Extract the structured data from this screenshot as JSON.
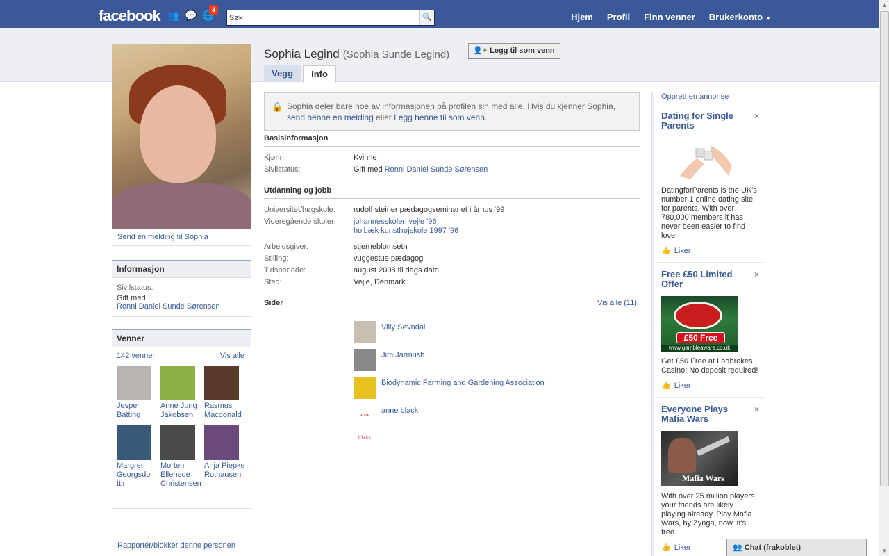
{
  "topbar": {
    "logo": "facebook",
    "notifications_count": "3",
    "search_value": "Søk",
    "nav": [
      "Hjem",
      "Profil",
      "Finn venner",
      "Brukerkonto"
    ]
  },
  "profile": {
    "name": "Sophia Legind",
    "altname": "(Sophia Sunde Legind)",
    "add_friend": "Legg til som venn",
    "tabs": [
      "Vegg",
      "Info"
    ],
    "send_message": "Send en melding til Sophia"
  },
  "sidebar": {
    "info_title": "Informasjon",
    "info_label": "Sivilstatus:",
    "info_value": "Gift med",
    "info_link": "Ronni Daniel Sunde Sørensen",
    "friends_title": "Venner",
    "friends_count": "142 venner",
    "friends_all": "Vis alle",
    "friends": [
      {
        "name": "Jesper Batting",
        "color": "#b9b4b0"
      },
      {
        "name": "Anne Jung Jakobsen",
        "color": "#8cb044"
      },
      {
        "name": "Rasmus Macdonald",
        "color": "#5a3a2a"
      },
      {
        "name": "Margret Georgsdo ttir",
        "color": "#3a5a7a"
      },
      {
        "name": "Morten Ellehede Christensen",
        "color": "#4a4a4a"
      },
      {
        "name": "Anja Piepke Rothausen",
        "color": "#6a4a7a"
      }
    ],
    "report": "Rapportér/blokkér denne personen"
  },
  "notice": {
    "text1": "Sophia deler bare noe av informasjonen på profilen sin med alle. Hvis du kjenner Sophia,",
    "link1": "send henne en melding",
    "text2": "eller",
    "link2": "Legg henne til som venn",
    "text3": "."
  },
  "basic": {
    "title": "Basisinformasjon",
    "rows": [
      {
        "k": "Kjønn:",
        "v": "Kvinne",
        "link": ""
      },
      {
        "k": "Sivilstatus:",
        "v": "Gift med",
        "link": "Ronni Daniel Sunde Sørensen"
      }
    ]
  },
  "education": {
    "title": "Utdanning og jobb",
    "university_label": "Universitet/høgskole:",
    "university": "rudolf steiner pædagogseminariet i århus '99",
    "school_label": "Videregående skoler:",
    "school1": "johannesskolen vejle '96",
    "school2": "holbæk kunsthøjskole 1997 '96",
    "employer_label": "Arbeidsgiver:",
    "employer": "stjerneblomsetn",
    "position_label": "Stilling:",
    "position": "vuggestue pædagog",
    "period_label": "Tidsperiode:",
    "period": "august 2008 til dags dato",
    "place_label": "Sted:",
    "place": "Vejle, Denmark"
  },
  "pages": {
    "title": "Sider",
    "see_all": "Vis alle (11)",
    "items": [
      {
        "name": "Villy Søvndal",
        "color": "#c8c0b0"
      },
      {
        "name": "Jim Jarmush",
        "color": "#888888"
      },
      {
        "name": "Biodynamic Farming and Gardening Association",
        "color": "#e8c020"
      },
      {
        "name": "anne black",
        "color": "#ffffff"
      }
    ],
    "anne_black_logo": "anne black"
  },
  "ads": {
    "create": "Opprett en annonse",
    "like": "Liker",
    "items": [
      {
        "title": "Dating for Single Parents",
        "text": "DatingforParents is the UK's number 1 online dating site for parents. With over 780,000 members it has never been easier to find love."
      },
      {
        "title": "Free £50 Limited Offer",
        "text": "Get £50 Free at Ladbrokes Casino! No deposit required!",
        "banner": "£50 Free",
        "url": "www.gambleaware.co.uk"
      },
      {
        "title": "Everyone Plays Mafia Wars",
        "text": "With over 25 million players, your friends are likely playing already. Play Mafia Wars, by Zynga, now. It's free.",
        "banner": "Mafia Wars"
      }
    ]
  },
  "chat": {
    "label": "Chat (frakoblet)"
  }
}
